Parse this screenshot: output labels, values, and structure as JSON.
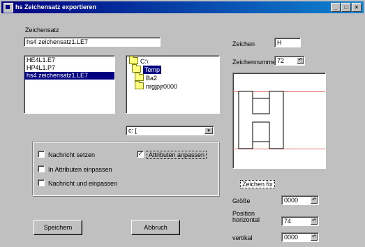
{
  "window": {
    "title": "hs Zeichensatz exportieren",
    "min_glyph": "_",
    "max_glyph": "□",
    "close_glyph": "×"
  },
  "charset_label": "Zeichensatz",
  "charset_value": "hs4 zeichensatz1.LE7",
  "file_list": {
    "items": [
      {
        "label": "HE4L1.E7",
        "selected": false
      },
      {
        "label": "HP4L1.P7",
        "selected": false
      },
      {
        "label": "hs4 zeichensatz1.LE7",
        "selected": true
      }
    ]
  },
  "dir_list": {
    "items": [
      {
        "label": "C:\\",
        "icon": "open-folder-icon",
        "selected": false
      },
      {
        "label": "Temp",
        "icon": "open-folder-icon",
        "selected": true
      },
      {
        "label": "Ba2",
        "icon": "folder-icon",
        "selected": false
      },
      {
        "label": "nrgjpjr0000",
        "icon": "folder-icon",
        "selected": false
      }
    ]
  },
  "drive": {
    "value": "c: [",
    "arrow": "▾"
  },
  "checkboxes": {
    "nachricht_setzen": {
      "label": "Nachricht setzen",
      "checked": false
    },
    "in_attributen": {
      "label": "In Attributen einpassen",
      "checked": false
    },
    "nachricht_und": {
      "label": "Nachricht und einpassen",
      "checked": false
    },
    "attributen": {
      "label": "Attributen anpassen",
      "checked": true
    }
  },
  "check_mark": "✓",
  "zeichen": {
    "label": "Zeichen",
    "value": "H"
  },
  "zeichennummer": {
    "label": "Zeichennummer",
    "value": "72"
  },
  "preview_glyph": "H",
  "zeichen_fix": {
    "label": "Zeichen fix"
  },
  "groesse": {
    "label": "Größe",
    "value": "0000"
  },
  "position": {
    "label_line1": "Position",
    "label_line2": "horizontal",
    "value": "74"
  },
  "vertikal": {
    "label": "vertikal",
    "value": "0000"
  },
  "spin_glyph": "▴▾",
  "buttons": {
    "speichern": "Speichern",
    "abbruch": "Abbruch"
  },
  "colors": {
    "titlebar_start": "#000080",
    "titlebar_end": "#1084d0",
    "selection": "#000080",
    "guide_lines": "#e07070",
    "face": "#c0c0c0"
  }
}
